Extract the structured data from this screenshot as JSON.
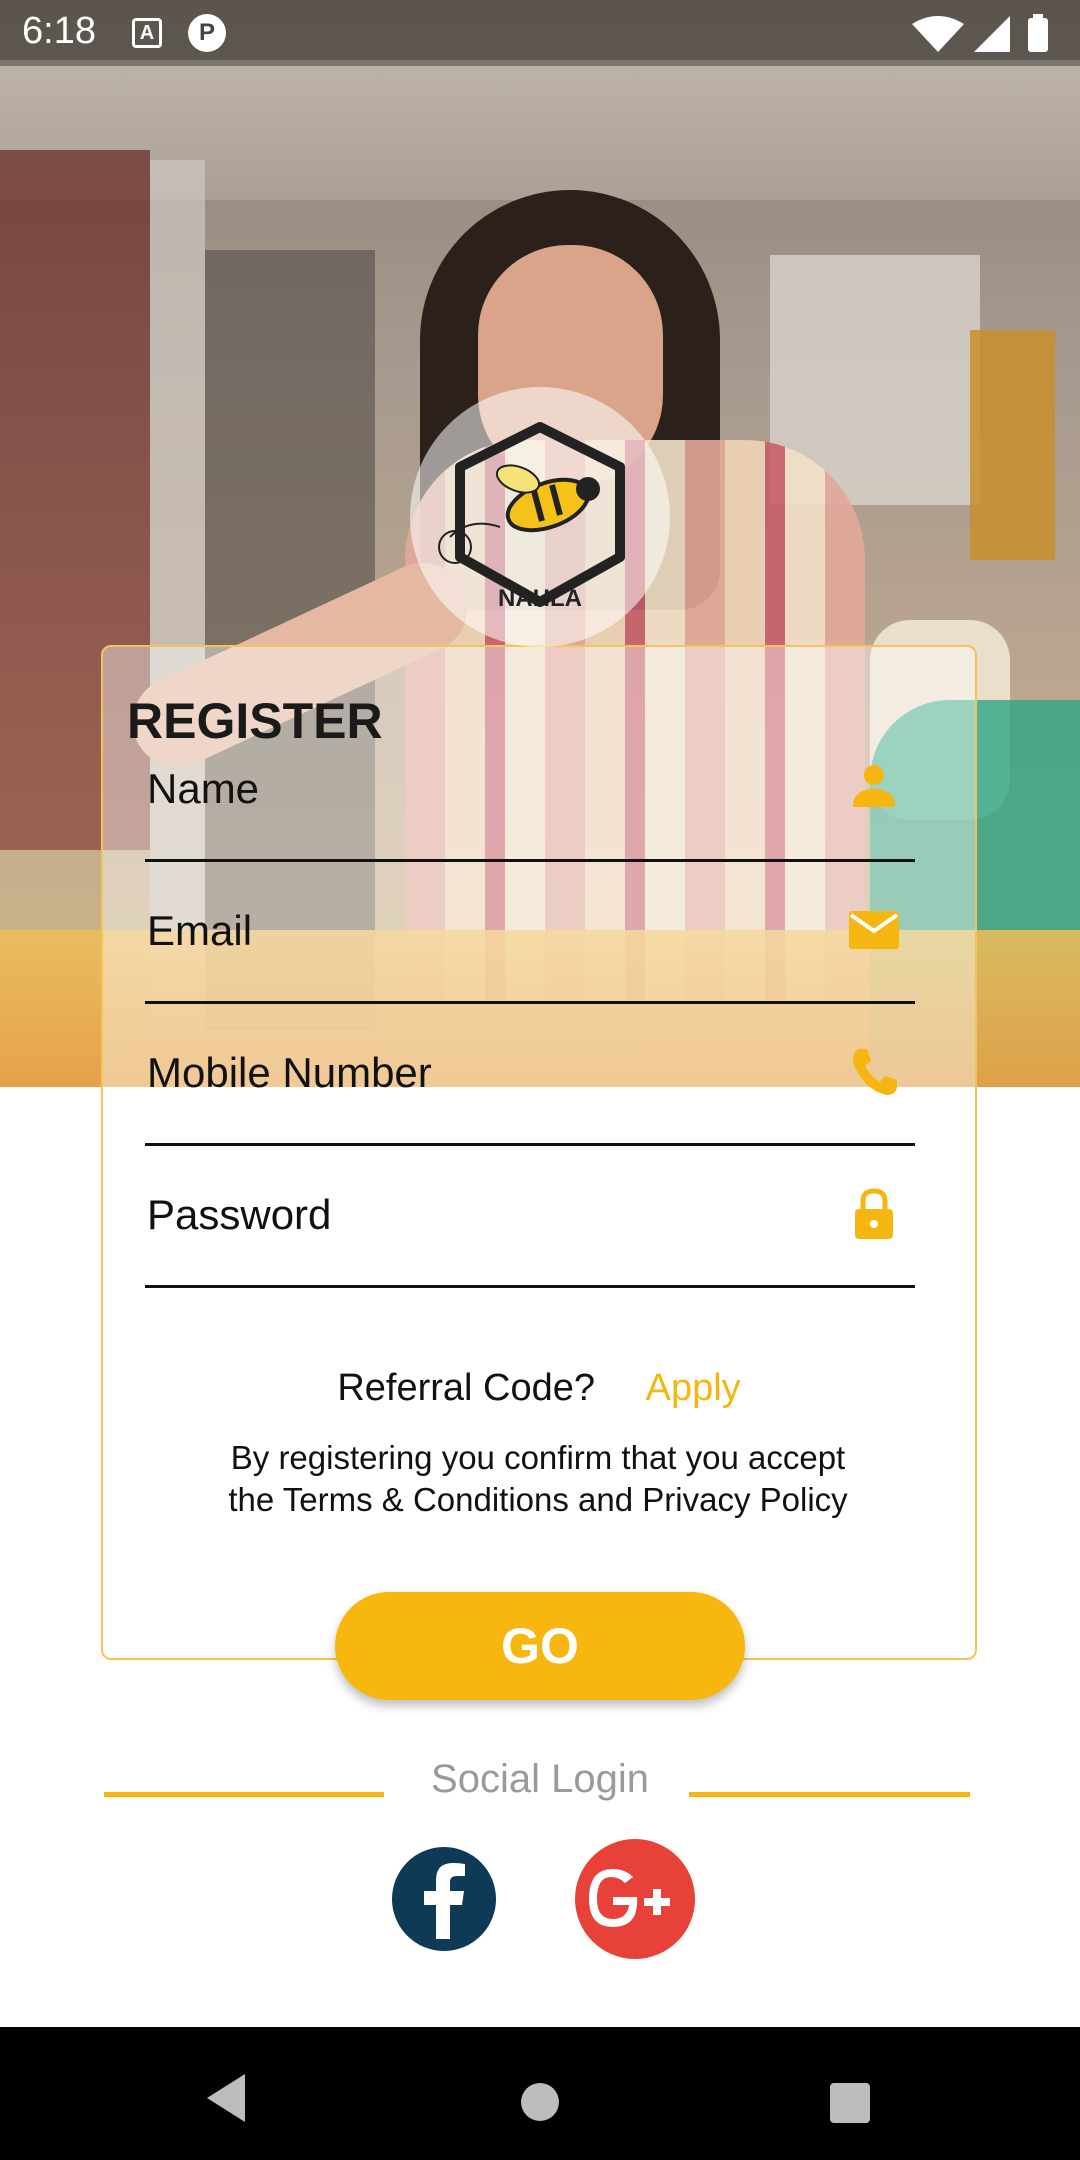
{
  "status_bar": {
    "time": "6:18",
    "a_icon": "A",
    "p_icon": "P"
  },
  "logo": {
    "text": "NAHLA",
    "icon": "bee-hexagon-logo"
  },
  "form": {
    "title": "REGISTER",
    "fields": [
      {
        "label": "Name",
        "icon": "person-icon"
      },
      {
        "label": "Email",
        "icon": "mail-icon"
      },
      {
        "label": "Mobile Number",
        "icon": "phone-icon"
      },
      {
        "label": "Password",
        "icon": "lock-icon"
      }
    ],
    "referral_text": "Referral Code?",
    "apply_label": "Apply",
    "terms_line1": "By registering you confirm that you accept",
    "terms_line2": "the Terms & Conditions and Privacy Policy",
    "go_label": "GO"
  },
  "social": {
    "label": "Social Login",
    "facebook": "f",
    "google": "G+"
  },
  "colors": {
    "accent": "#f7b70e",
    "facebook": "#0e3a56",
    "google": "#e8413a"
  }
}
